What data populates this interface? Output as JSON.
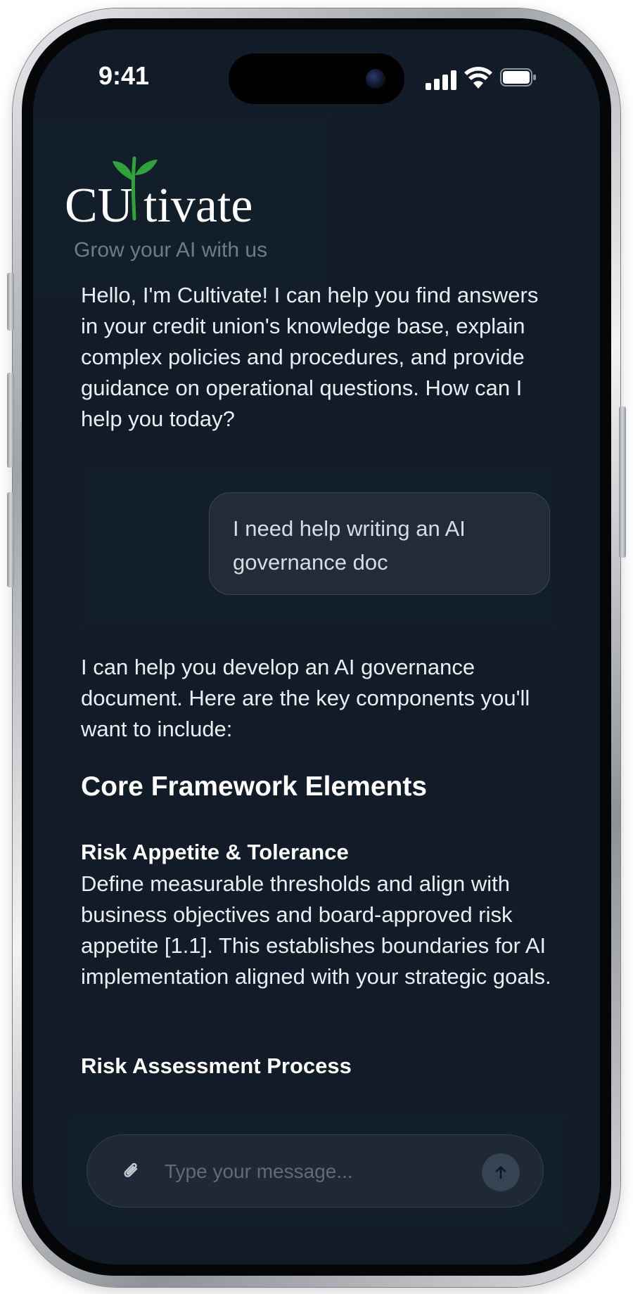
{
  "status_bar": {
    "time": "9:41"
  },
  "app": {
    "logo_text": "CUltivate",
    "tagline": "Grow your AI with us"
  },
  "messages": {
    "welcome": "Hello, I'm Cultivate! I can help you find answers in your credit union's knowledge base, explain complex policies and procedures, and provide guidance on operational questions. How can I help you today?",
    "user": "I need help writing an AI governance doc",
    "reply": {
      "intro": "I can help you develop an AI governance document. Here are the key components you'll want to include:",
      "heading": "Core Framework Elements",
      "section1_title": "Risk Appetite & Tolerance",
      "section1_body": "Define measurable thresholds and align with business objectives and board-approved risk appetite [1.1]. This establishes boundaries for AI implementation aligned with your strategic goals.",
      "section2_title": "Risk Assessment Process"
    }
  },
  "composer": {
    "placeholder": "Type your message...",
    "attach_icon": "paperclip-icon",
    "send_icon": "arrow-up-icon"
  },
  "colors": {
    "background": "#121c29",
    "bubble": "#222c38",
    "leaf_green": "#2fa33a",
    "text": "#eaedf1"
  }
}
